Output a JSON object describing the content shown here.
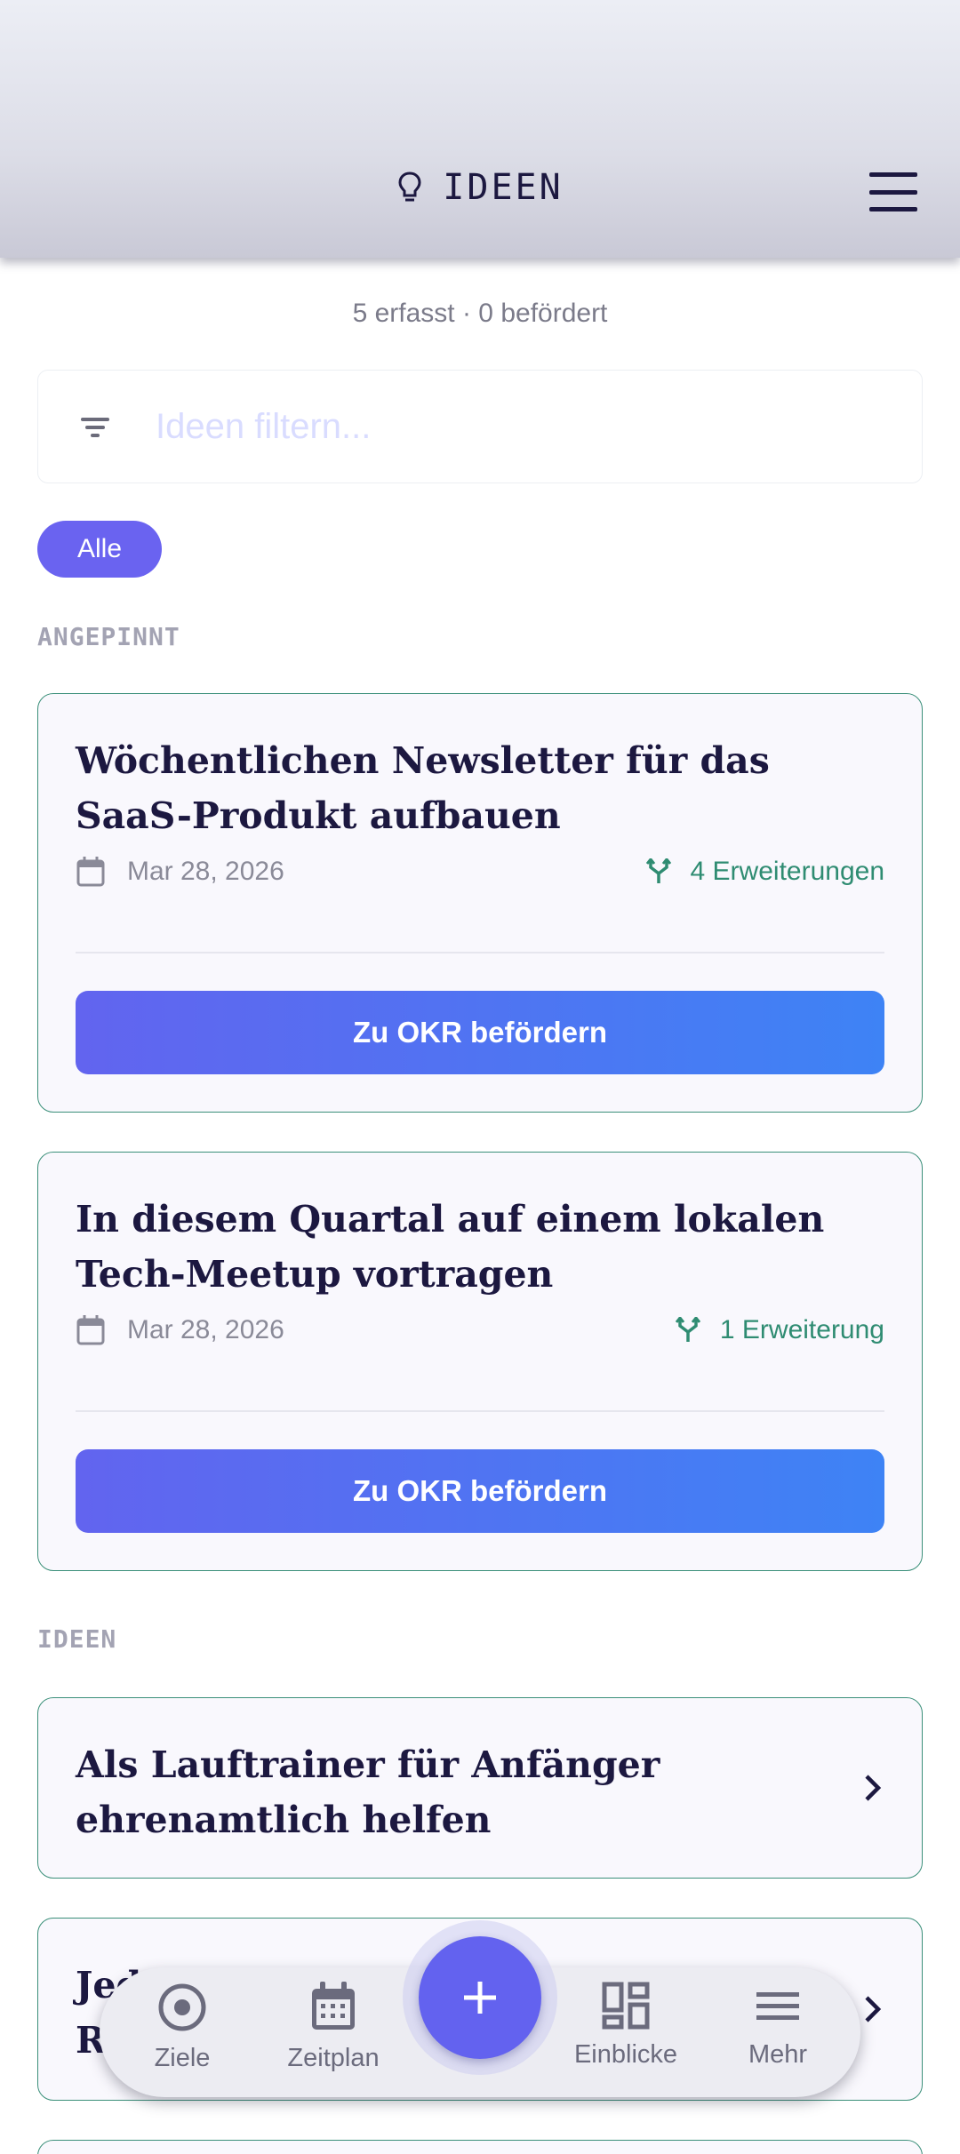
{
  "header": {
    "title": "IDEEN",
    "icon": "lightbulb-icon",
    "menu_icon": "hamburger-menu-icon"
  },
  "summary": "5 erfasst · 0 befördert",
  "filter": {
    "placeholder": "Ideen filtern...",
    "value": "",
    "icon": "filter-icon"
  },
  "chips": [
    {
      "label": "Alle",
      "selected": true
    }
  ],
  "sections": {
    "pinned": {
      "label": "ANGEPINNT",
      "cards": [
        {
          "title": "Wöchentlichen Newsletter für das SaaS-Produkt aufbauen",
          "date": "Mar 28, 2026",
          "extensions": "4 Erweiterungen",
          "button": "Zu OKR befördern"
        },
        {
          "title": "In diesem Quartal auf einem lokalen Tech-Meetup vortragen",
          "date": "Mar 28, 2026",
          "extensions": "1 Erweiterung",
          "button": "Zu OKR befördern"
        }
      ]
    },
    "ideas": {
      "label": "IDEEN",
      "cards": [
        {
          "title": "Als Lauftrainer für Anfänger ehrenamtlich helfen"
        },
        {
          "title_partial": "Jed… R…"
        }
      ]
    }
  },
  "nav": {
    "items": [
      {
        "label": "Ziele",
        "icon": "target-icon"
      },
      {
        "label": "Zeitplan",
        "icon": "calendar-icon"
      },
      {
        "label": "Einblicke",
        "icon": "dashboard-icon"
      },
      {
        "label": "Mehr",
        "icon": "menu-icon"
      }
    ],
    "fab_icon": "plus-icon"
  },
  "colors": {
    "accent": "#6362ef",
    "card_border": "#3a8f79",
    "extension_text": "#2f8c72",
    "button_gradient_start": "#6264ef",
    "button_gradient_end": "#3e83f5"
  }
}
